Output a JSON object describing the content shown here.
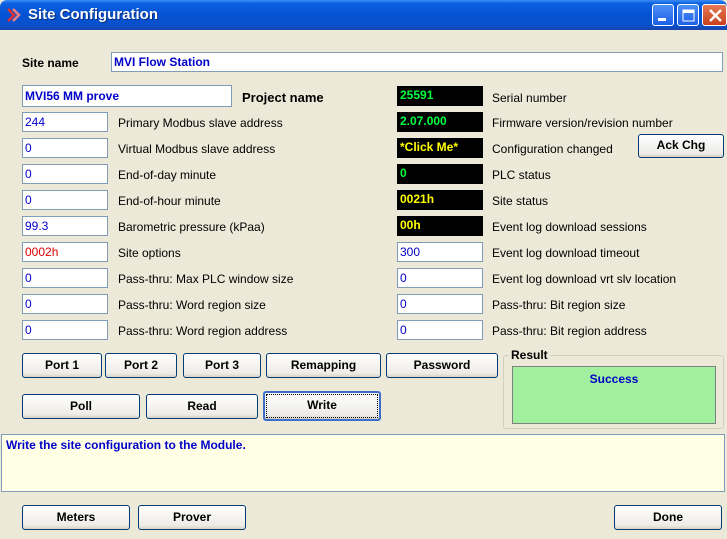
{
  "window": {
    "title": "Site Configuration"
  },
  "site": {
    "name_label": "Site name",
    "name_value": "MVI Flow Station",
    "project_value": "MVI56 MM prove",
    "project_label": "Project name"
  },
  "left_fields": [
    {
      "value": "244",
      "label": "Primary Modbus slave address",
      "color": "blue"
    },
    {
      "value": "0",
      "label": "Virtual Modbus slave address",
      "color": "blue"
    },
    {
      "value": "0",
      "label": "End-of-day minute",
      "color": "blue"
    },
    {
      "value": "0",
      "label": "End-of-hour minute",
      "color": "blue"
    },
    {
      "value": "99.3",
      "label": "Barometric pressure (kPaa)",
      "color": "blue"
    },
    {
      "value": "0002h",
      "label": "Site options",
      "color": "red"
    },
    {
      "value": "0",
      "label": "Pass-thru: Max PLC window size",
      "color": "blue"
    },
    {
      "value": "0",
      "label": "Pass-thru: Word region size",
      "color": "blue"
    },
    {
      "value": "0",
      "label": "Pass-thru: Word region address",
      "color": "blue"
    }
  ],
  "right_status": [
    {
      "value": "25591",
      "label": "Serial number",
      "color": "green"
    },
    {
      "value": "2.07.000",
      "label": "Firmware version/revision number",
      "color": "green"
    },
    {
      "value": "*Click Me*",
      "label": "Configuration changed",
      "color": "yellow"
    },
    {
      "value": "0",
      "label": "PLC status",
      "color": "green"
    },
    {
      "value": "0021h",
      "label": "Site status",
      "color": "yellow"
    },
    {
      "value": "00h",
      "label": "Event log download sessions",
      "color": "yellow"
    }
  ],
  "right_fields": [
    {
      "value": "300",
      "label": "Event log download timeout"
    },
    {
      "value": "0",
      "label": "Event log download vrt slv location"
    },
    {
      "value": "0",
      "label": "Pass-thru: Bit region size"
    },
    {
      "value": "0",
      "label": "Pass-thru: Bit region address"
    }
  ],
  "buttons": {
    "ack_chg": "Ack Chg",
    "port1": "Port 1",
    "port2": "Port 2",
    "port3": "Port 3",
    "remapping": "Remapping",
    "password": "Password",
    "poll": "Poll",
    "read": "Read",
    "write": "Write",
    "meters": "Meters",
    "prover": "Prover",
    "done": "Done"
  },
  "result": {
    "title": "Result",
    "value": "Success"
  },
  "status_message": "Write the site configuration to the Module."
}
